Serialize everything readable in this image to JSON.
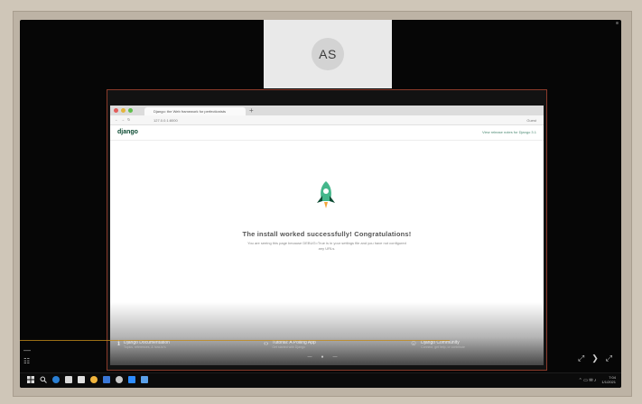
{
  "participant": {
    "initials": "AS"
  },
  "browser": {
    "tab_title": "Django: the Web framework for perfectionists",
    "new_tab_symbol": "+",
    "url": "127.0.0.1:8000",
    "nav_buttons": [
      "←",
      "→",
      "↻"
    ],
    "toolbar_right": "Guest"
  },
  "django_page": {
    "logo": "django",
    "release_link": "View release notes for Django 3.1",
    "heading": "The install worked successfully! Congratulations!",
    "subtext": "You are seeing this page because DEBUG=True is in your settings file and you have not configured any URLs.",
    "footer_links": [
      {
        "icon": "ℹ",
        "title": "Django Documentation",
        "subtitle": "Topics, references, & how-to's"
      },
      {
        "icon": "‹›",
        "title": "Tutorial: A Polling App",
        "subtitle": "Get started with Django"
      },
      {
        "icon": "☺",
        "title": "Django Community",
        "subtitle": "Connect, get help, or contribute"
      }
    ],
    "mini_controls": [
      "—",
      "●",
      "—"
    ]
  },
  "meeting_controls": {
    "left": [
      "—",
      "☷"
    ],
    "right": [
      "⤢",
      "❯",
      "⤢"
    ]
  },
  "taskbar": {
    "clock_time": "7:04",
    "clock_date": "1/1/2021",
    "tray_symbols": "⌃ ▭ ✉ ♪"
  },
  "colors": {
    "django_green": "#0c4b33",
    "rocket": "#44b78b",
    "meeting_bg": "#060606"
  }
}
